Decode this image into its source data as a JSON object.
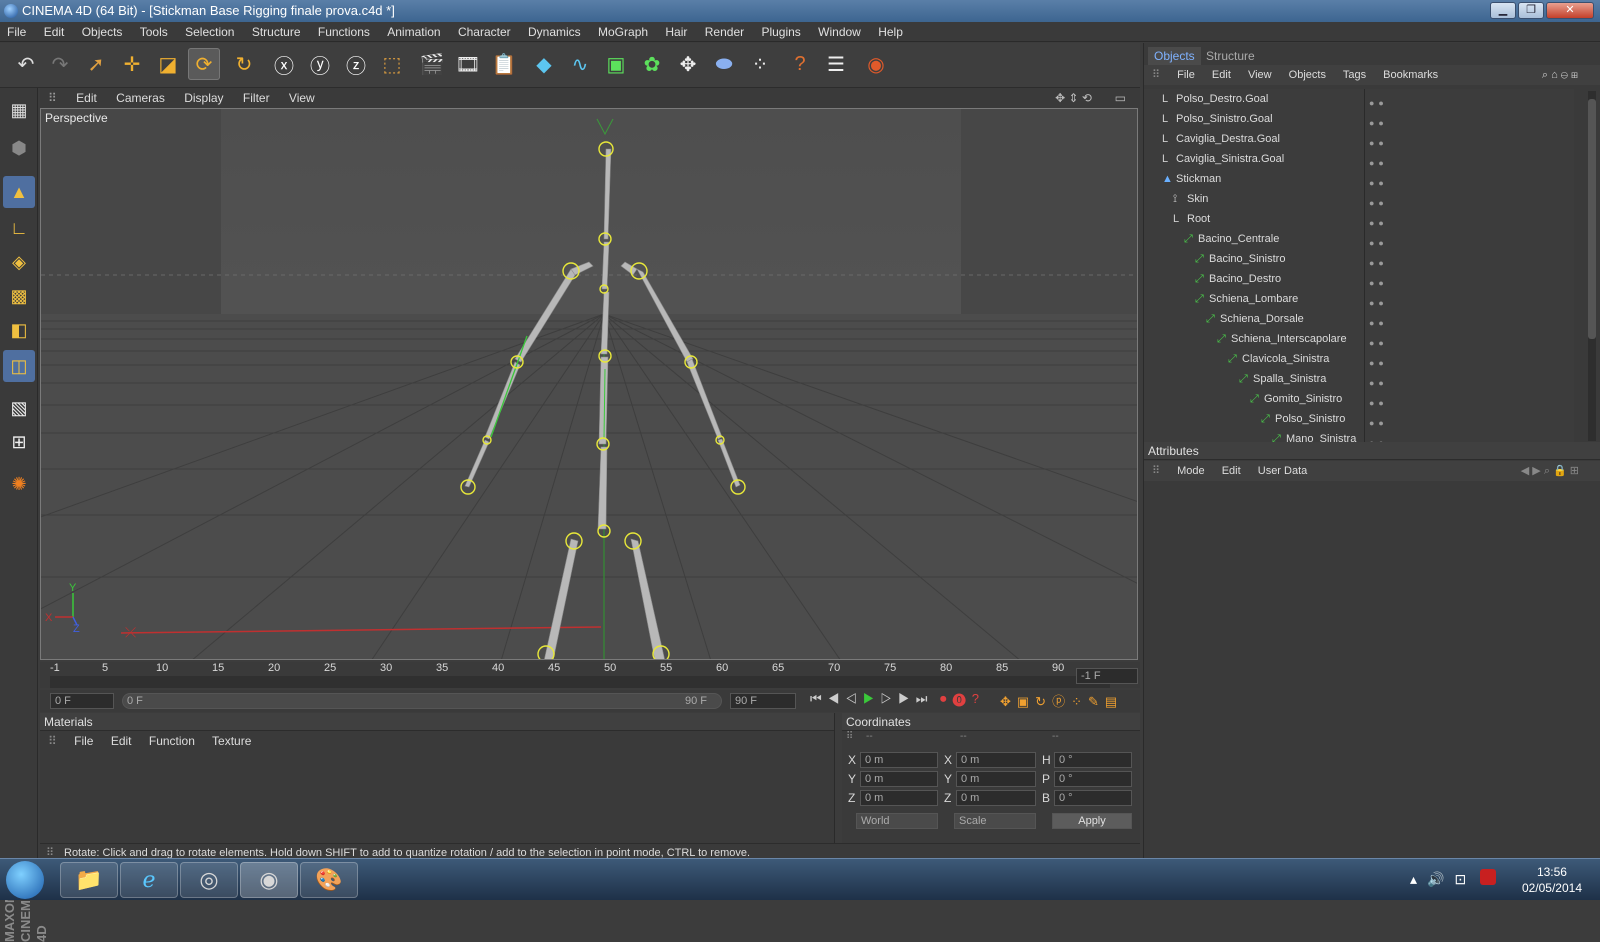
{
  "window": {
    "title": "CINEMA 4D (64 Bit) - [Stickman Base Rigging finale prova.c4d *]"
  },
  "menubar": [
    "File",
    "Edit",
    "Objects",
    "Tools",
    "Selection",
    "Structure",
    "Functions",
    "Animation",
    "Character",
    "Dynamics",
    "MoGraph",
    "Hair",
    "Render",
    "Plugins",
    "Window",
    "Help"
  ],
  "viewport": {
    "menu": [
      "Edit",
      "Cameras",
      "Display",
      "Filter",
      "View"
    ],
    "label": "Perspective",
    "axis_labels": {
      "y": "Y",
      "x": "X",
      "z": "Z"
    }
  },
  "timeline": {
    "ticks": [
      "-1",
      "5",
      "10",
      "15",
      "20",
      "25",
      "30",
      "35",
      "40",
      "45",
      "50",
      "55",
      "60",
      "65",
      "70",
      "75",
      "80",
      "85",
      "90"
    ],
    "end_field": "-1 F",
    "current_frame": "0 F",
    "range_start": "0 F",
    "range_end": "90 F",
    "max_frame": "90 F"
  },
  "materials": {
    "title": "Materials",
    "menu": [
      "File",
      "Edit",
      "Function",
      "Texture"
    ]
  },
  "coordinates": {
    "title": "Coordinates",
    "headers": [
      "--",
      "--",
      "--"
    ],
    "rows": [
      {
        "a": "X",
        "av": "0 m",
        "b": "X",
        "bv": "0 m",
        "c": "H",
        "cv": "0 °"
      },
      {
        "a": "Y",
        "av": "0 m",
        "b": "Y",
        "bv": "0 m",
        "c": "P",
        "cv": "0 °"
      },
      {
        "a": "Z",
        "av": "0 m",
        "b": "Z",
        "bv": "0 m",
        "c": "B",
        "cv": "0 °"
      }
    ],
    "world": "World",
    "scale": "Scale",
    "apply": "Apply"
  },
  "status": "Rotate: Click and drag to rotate elements. Hold down SHIFT to add to quantize rotation / add to the selection in point mode, CTRL to remove.",
  "objects_panel": {
    "tabs": [
      "Objects",
      "Structure"
    ],
    "menu": [
      "File",
      "Edit",
      "View",
      "Objects",
      "Tags",
      "Bookmarks"
    ],
    "items": [
      {
        "name": "Polso_Destro.Goal",
        "indent": 0
      },
      {
        "name": "Polso_Sinistro.Goal",
        "indent": 0
      },
      {
        "name": "Caviglia_Destra.Goal",
        "indent": 0
      },
      {
        "name": "Caviglia_Sinistra.Goal",
        "indent": 0
      },
      {
        "name": "Stickman",
        "indent": 0
      },
      {
        "name": "Skin",
        "indent": 1
      },
      {
        "name": "Root",
        "indent": 1
      },
      {
        "name": "Bacino_Centrale",
        "indent": 2
      },
      {
        "name": "Bacino_Sinistro",
        "indent": 3
      },
      {
        "name": "Bacino_Destro",
        "indent": 3
      },
      {
        "name": "Schiena_Lombare",
        "indent": 3
      },
      {
        "name": "Schiena_Dorsale",
        "indent": 4
      },
      {
        "name": "Schiena_Interscapolare",
        "indent": 5
      },
      {
        "name": "Clavicola_Sinistra",
        "indent": 6
      },
      {
        "name": "Spalla_Sinistra",
        "indent": 7
      },
      {
        "name": "Gomito_Sinistro",
        "indent": 8
      },
      {
        "name": "Polso_Sinistro",
        "indent": 9
      },
      {
        "name": "Mano_Sinistra",
        "indent": 10
      }
    ]
  },
  "attributes_panel": {
    "title": "Attributes",
    "menu": [
      "Mode",
      "Edit",
      "User Data"
    ]
  },
  "brand": "MAXON CINEMA 4D",
  "taskbar": {
    "time": "13:56",
    "date": "02/05/2014"
  },
  "colors": {
    "accent": "#7fb2ff",
    "bone": "#b8b8b8",
    "joint": "#e8e83a",
    "grid_x_axis": "#c03030"
  }
}
